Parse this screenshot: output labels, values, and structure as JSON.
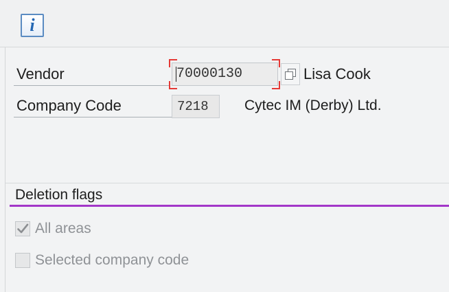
{
  "toolbar": {
    "info_icon_glyph": "i",
    "info_icon_name": "info-icon"
  },
  "form": {
    "vendor_label": "Vendor",
    "vendor_value": "70000130",
    "vendor_name": "Lisa Cook",
    "company_code_label": "Company Code",
    "company_code_value": "7218",
    "company_name": "Cytec IM (Derby) Ltd."
  },
  "deletion_flags": {
    "title": "Deletion flags",
    "options": [
      {
        "label": "All areas",
        "checked": true,
        "disabled": true
      },
      {
        "label": "Selected company code",
        "checked": false,
        "disabled": true
      }
    ]
  },
  "colors": {
    "accent_underline": "#a236c8",
    "focus_corners": "#e53935",
    "info_blue": "#2467b3"
  }
}
